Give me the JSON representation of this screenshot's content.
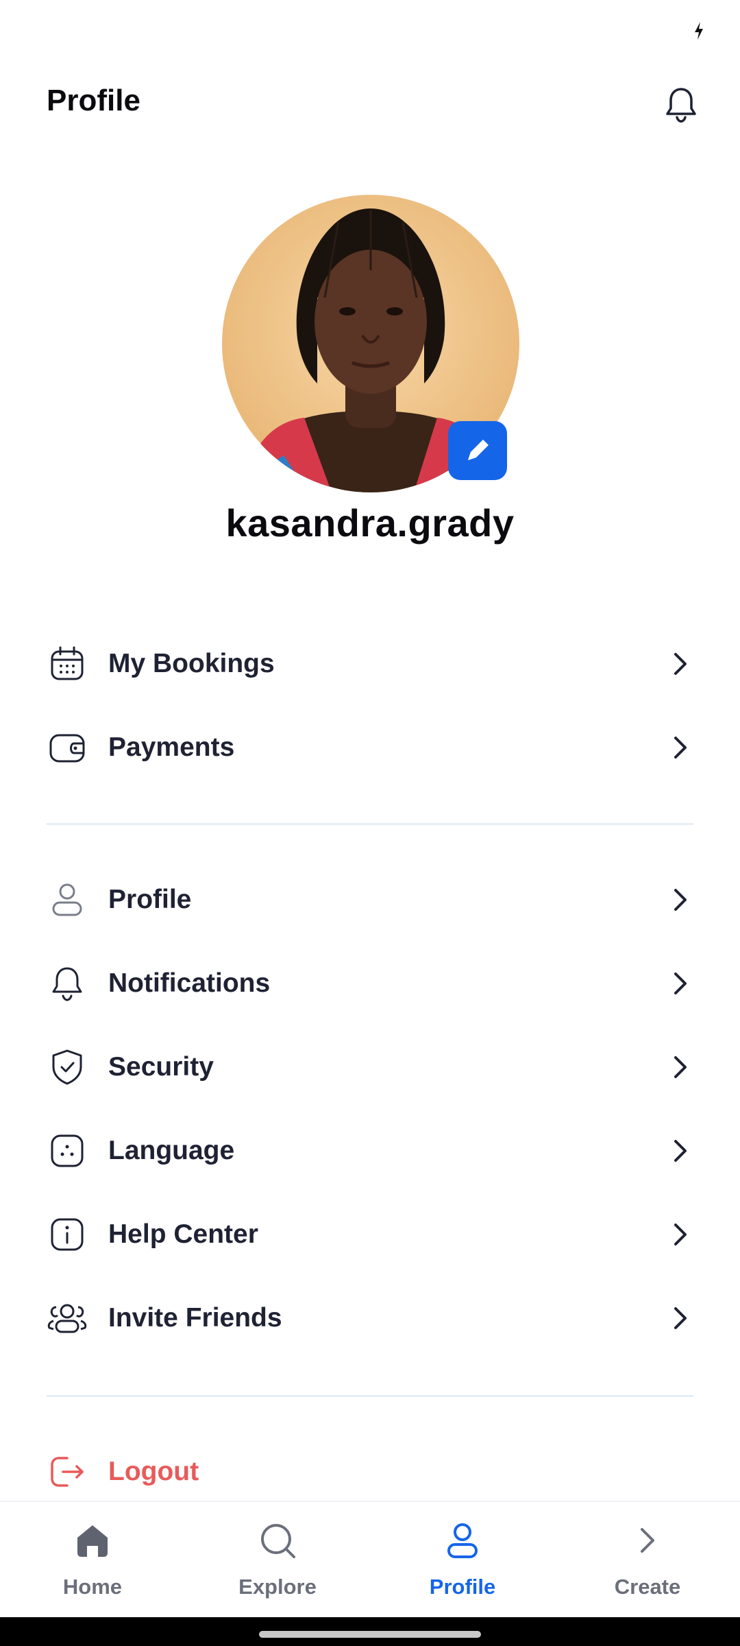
{
  "header": {
    "title": "Profile"
  },
  "profile": {
    "username": "kasandra.grady"
  },
  "menu_group_1": [
    {
      "label": "My Bookings",
      "icon": "calendar-icon"
    },
    {
      "label": "Payments",
      "icon": "wallet-icon"
    }
  ],
  "menu_group_2": [
    {
      "label": "Profile",
      "icon": "user-icon"
    },
    {
      "label": "Notifications",
      "icon": "bell-icon"
    },
    {
      "label": "Security",
      "icon": "shield-check-icon"
    },
    {
      "label": "Language",
      "icon": "language-icon"
    },
    {
      "label": "Help Center",
      "icon": "info-icon"
    },
    {
      "label": "Invite Friends",
      "icon": "users-icon"
    }
  ],
  "logout": {
    "label": "Logout",
    "icon": "logout-icon",
    "color": "#e85a5a"
  },
  "bottom_nav": [
    {
      "label": "Home",
      "icon": "home-icon",
      "active": false
    },
    {
      "label": "Explore",
      "icon": "search-icon",
      "active": false
    },
    {
      "label": "Profile",
      "icon": "user-icon",
      "active": true
    },
    {
      "label": "Create",
      "icon": "chevron-right-icon",
      "active": false
    }
  ],
  "colors": {
    "accent": "#1565e9",
    "danger": "#e85a5a",
    "text": "#1e2233",
    "muted": "#6b6f7b"
  }
}
